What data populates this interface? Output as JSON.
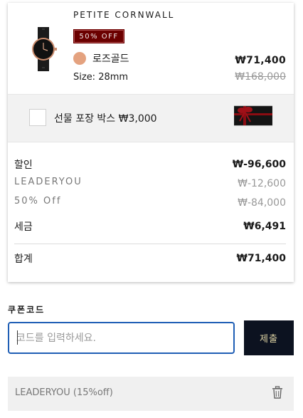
{
  "product": {
    "name": "PETITE CORNWALL",
    "badge": "50% OFF",
    "color_name": "로즈골드",
    "color_swatch": "#e4a27f",
    "size": "Size: 28mm",
    "price": "₩71,400",
    "original_price": "₩168,000",
    "image_icon": "watch-image"
  },
  "gift": {
    "label": "선물 포장 박스 ₩3,000",
    "checked": false,
    "image_icon": "gift-box-image"
  },
  "summary": {
    "discount_label": "할인",
    "discount_value": "₩-96,600",
    "coupon_code_label": "LEADERYOU",
    "coupon_code_value": "₩-12,600",
    "percent_label": "50% Off",
    "percent_value": "₩-84,000",
    "tax_label": "세금",
    "tax_value": "₩6,491",
    "total_label": "합계",
    "total_value": "₩71,400"
  },
  "coupon": {
    "label": "쿠폰코드",
    "placeholder": "코드를 입력하세요.",
    "value": "",
    "submit_label": "제출",
    "applied_label": "LEADERYOU (15%off)",
    "remove_icon": "trash-icon"
  },
  "colors": {
    "badge_bg": "#6b0000",
    "submit_bg": "#0c1220",
    "submit_text": "#ddd2a3",
    "input_focus_border": "#1f5eb5"
  }
}
